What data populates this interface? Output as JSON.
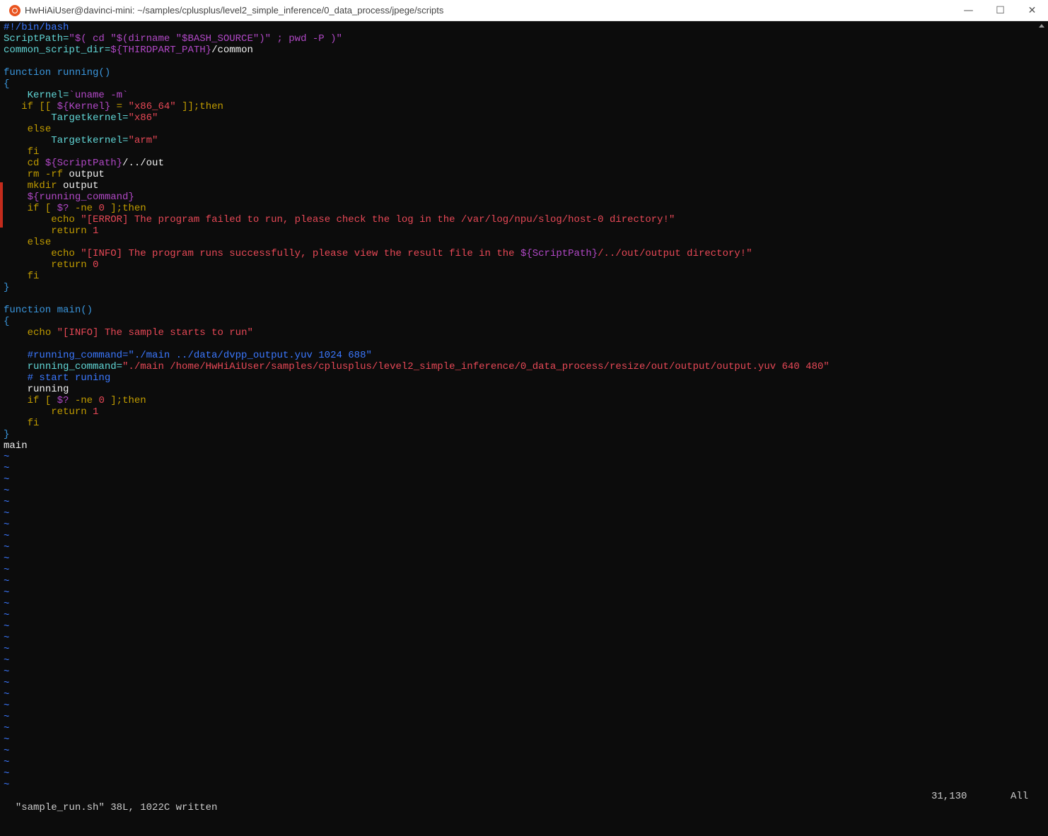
{
  "window": {
    "title": "HwHiAiUser@davinci-mini: ~/samples/cplusplus/level2_simple_inference/0_data_process/jpege/scripts",
    "minimize": "—",
    "maximize": "☐",
    "close": "✕"
  },
  "code": [
    [
      [
        "#!/bin/bash",
        "c-comment"
      ]
    ],
    [
      [
        "ScriptPath=",
        "c-ident"
      ],
      [
        "\"$( cd \"$(dirname \"$BASH_SOURCE\")\" ; pwd -P )\"",
        "c-sub"
      ]
    ],
    [
      [
        "common_script_dir=",
        "c-ident"
      ],
      [
        "${THIRDPART_PATH}",
        "c-sub"
      ],
      [
        "/common",
        "c-white"
      ]
    ],
    [],
    [
      [
        "function running()",
        "c-fn"
      ]
    ],
    [
      [
        "{",
        "c-fn"
      ]
    ],
    [
      [
        "    ",
        ""
      ],
      [
        "Kernel=",
        "c-ident"
      ],
      [
        "`uname -m`",
        "c-sub"
      ]
    ],
    [
      [
        "   ",
        ""
      ],
      [
        "if [[ ",
        "c-kw"
      ],
      [
        "${Kernel}",
        "c-sub"
      ],
      [
        " = ",
        "c-kw"
      ],
      [
        "\"x86_64\"",
        "c-str"
      ],
      [
        " ]];then",
        "c-kw"
      ]
    ],
    [
      [
        "        ",
        ""
      ],
      [
        "Targetkernel=",
        "c-ident"
      ],
      [
        "\"x86\"",
        "c-str"
      ]
    ],
    [
      [
        "    ",
        ""
      ],
      [
        "else",
        "c-kw"
      ]
    ],
    [
      [
        "        ",
        ""
      ],
      [
        "Targetkernel=",
        "c-ident"
      ],
      [
        "\"arm\"",
        "c-str"
      ]
    ],
    [
      [
        "    ",
        ""
      ],
      [
        "fi",
        "c-kw"
      ]
    ],
    [
      [
        "    ",
        ""
      ],
      [
        "cd ",
        "c-kw"
      ],
      [
        "${ScriptPath}",
        "c-sub"
      ],
      [
        "/../out",
        "c-white"
      ]
    ],
    [
      [
        "    ",
        ""
      ],
      [
        "rm -rf ",
        "c-kw"
      ],
      [
        "output",
        "c-white"
      ]
    ],
    [
      [
        "    ",
        ""
      ],
      [
        "mkdir ",
        "c-kw"
      ],
      [
        "output",
        "c-white"
      ]
    ],
    [
      [
        "    ",
        ""
      ],
      [
        "${running_command}",
        "c-sub"
      ]
    ],
    [
      [
        "    ",
        ""
      ],
      [
        "if [ ",
        "c-kw"
      ],
      [
        "$?",
        "c-sub"
      ],
      [
        " -ne ",
        "c-kw"
      ],
      [
        "0",
        "c-str"
      ],
      [
        " ];then",
        "c-kw"
      ]
    ],
    [
      [
        "        ",
        ""
      ],
      [
        "echo ",
        "c-kw"
      ],
      [
        "\"[ERROR] The program failed to run, please check the log in the /var/log/npu/slog/host-0 directory!\"",
        "c-str"
      ]
    ],
    [
      [
        "        ",
        ""
      ],
      [
        "return ",
        "c-kw"
      ],
      [
        "1",
        "c-str"
      ]
    ],
    [
      [
        "    ",
        ""
      ],
      [
        "else",
        "c-kw"
      ]
    ],
    [
      [
        "        ",
        ""
      ],
      [
        "echo ",
        "c-kw"
      ],
      [
        "\"[INFO] The program runs successfully, please view the result file in the ",
        "c-str"
      ],
      [
        "${ScriptPath}",
        "c-sub"
      ],
      [
        "/../out/output directory!\"",
        "c-str"
      ]
    ],
    [
      [
        "        ",
        ""
      ],
      [
        "return ",
        "c-kw"
      ],
      [
        "0",
        "c-str"
      ]
    ],
    [
      [
        "    ",
        ""
      ],
      [
        "fi",
        "c-kw"
      ]
    ],
    [
      [
        "}",
        "c-fn"
      ]
    ],
    [],
    [
      [
        "function main()",
        "c-fn"
      ]
    ],
    [
      [
        "{",
        "c-fn"
      ]
    ],
    [
      [
        "    ",
        ""
      ],
      [
        "echo ",
        "c-kw"
      ],
      [
        "\"[INFO] The sample starts to run\"",
        "c-str"
      ]
    ],
    [],
    [
      [
        "    ",
        ""
      ],
      [
        "#running_command=\"./main ../data/dvpp_output.yuv 1024 688\"",
        "c-comment"
      ]
    ],
    [
      [
        "    ",
        ""
      ],
      [
        "running_command=",
        "c-ident"
      ],
      [
        "\"./main /home/HwHiAiUser/samples/cplusplus/level2_simple_inference/0_data_process/resize/out/output/output.yuv 640 480\"",
        "c-str"
      ]
    ],
    [
      [
        "    ",
        ""
      ],
      [
        "# start runing",
        "c-comment"
      ]
    ],
    [
      [
        "    ",
        ""
      ],
      [
        "running",
        "c-white"
      ]
    ],
    [
      [
        "    ",
        ""
      ],
      [
        "if [ ",
        "c-kw"
      ],
      [
        "$?",
        "c-sub"
      ],
      [
        " -ne ",
        "c-kw"
      ],
      [
        "0",
        "c-str"
      ],
      [
        " ];then",
        "c-kw"
      ]
    ],
    [
      [
        "        ",
        ""
      ],
      [
        "return ",
        "c-kw"
      ],
      [
        "1",
        "c-str"
      ]
    ],
    [
      [
        "    ",
        ""
      ],
      [
        "fi",
        "c-kw"
      ]
    ],
    [
      [
        "}",
        "c-fn"
      ]
    ],
    [
      [
        "main",
        "c-white"
      ]
    ]
  ],
  "tilde_count": 30,
  "tilde_char": "~",
  "status": {
    "message": "\"sample_run.sh\" 38L, 1022C written",
    "position": "31,130",
    "scroll": "All"
  }
}
